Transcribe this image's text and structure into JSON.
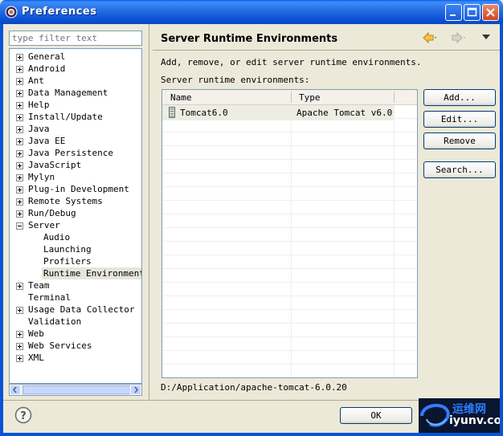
{
  "window": {
    "title": "Preferences"
  },
  "filter": {
    "placeholder": "type filter text"
  },
  "tree": {
    "items": [
      {
        "label": "General",
        "expander": "plus"
      },
      {
        "label": "Android",
        "expander": "plus"
      },
      {
        "label": "Ant",
        "expander": "plus"
      },
      {
        "label": "Data Management",
        "expander": "plus"
      },
      {
        "label": "Help",
        "expander": "plus"
      },
      {
        "label": "Install/Update",
        "expander": "plus"
      },
      {
        "label": "Java",
        "expander": "plus"
      },
      {
        "label": "Java EE",
        "expander": "plus"
      },
      {
        "label": "Java Persistence",
        "expander": "plus"
      },
      {
        "label": "JavaScript",
        "expander": "plus"
      },
      {
        "label": "Mylyn",
        "expander": "plus"
      },
      {
        "label": "Plug-in Development",
        "expander": "plus"
      },
      {
        "label": "Remote Systems",
        "expander": "plus"
      },
      {
        "label": "Run/Debug",
        "expander": "plus"
      },
      {
        "label": "Server",
        "expander": "minus"
      },
      {
        "label": "Audio",
        "expander": "none",
        "child": true
      },
      {
        "label": "Launching",
        "expander": "none",
        "child": true
      },
      {
        "label": "Profilers",
        "expander": "none",
        "child": true
      },
      {
        "label": "Runtime Environments",
        "expander": "none",
        "child": true,
        "selected": true
      },
      {
        "label": "Team",
        "expander": "plus"
      },
      {
        "label": "Terminal",
        "expander": "none"
      },
      {
        "label": "Usage Data Collector",
        "expander": "plus"
      },
      {
        "label": "Validation",
        "expander": "none"
      },
      {
        "label": "Web",
        "expander": "plus"
      },
      {
        "label": "Web Services",
        "expander": "plus"
      },
      {
        "label": "XML",
        "expander": "plus"
      }
    ]
  },
  "page": {
    "title": "Server Runtime Environments",
    "description": "Add, remove, or edit server runtime environments.",
    "list_label": "Server runtime environments:",
    "columns": [
      "Name",
      "Type"
    ],
    "rows": [
      {
        "name": "Tomcat6.0",
        "type": "Apache Tomcat v6.0"
      }
    ],
    "path": "D:/Application/apache-tomcat-6.0.20"
  },
  "buttons": {
    "add": "Add...",
    "edit": "Edit...",
    "remove": "Remove",
    "search": "Search...",
    "ok": "OK"
  },
  "watermark": {
    "cn": "运维网",
    "en": "iyunv.com"
  },
  "colors": {
    "titlebar": "#0A52D6",
    "selection": "#E7E5DA",
    "window_bg": "#ECE9D8"
  }
}
